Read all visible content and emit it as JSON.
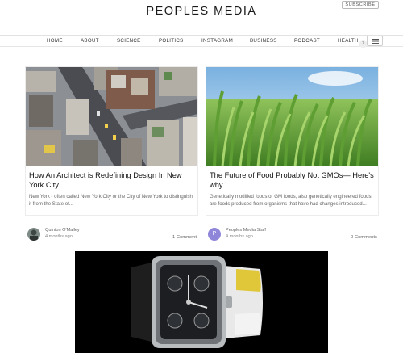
{
  "header": {
    "site_title": "PEOPLES MEDIA",
    "subscribe_label": "SUBSCRIBE"
  },
  "nav": {
    "items": [
      "HOME",
      "ABOUT",
      "SCIENCE",
      "POLITICS",
      "INSTAGRAM",
      "BUSINESS",
      "PODCAST",
      "HEALTH"
    ],
    "badge": "7",
    "menu_icon": "hamburger-icon"
  },
  "articles": [
    {
      "title": "How An Architect is Redefining Design In New York City",
      "excerpt": "New York - often called New York City or the City of New York to distinguish it from the State of...",
      "author": "Quinton O'Malley",
      "date": "4 months ago",
      "comments": "1 Comment",
      "image": "aerial-city-streets"
    },
    {
      "title": "The Future of Food Probably Not GMOs— Here's why",
      "excerpt": "Genetically modified foods or GM foods, also genetically engineered foods, are foods produced from organisms that have had changes introduced...",
      "author": "Peoples Media Staff",
      "author_initial": "P",
      "date": "4 months ago",
      "comments": "0 Comments",
      "image": "wheat-field-sky"
    }
  ],
  "advertisement": {
    "image": "luxury-wristwatch"
  },
  "colors": {
    "text": "#222222",
    "muted": "#666666",
    "border": "#e2e2e2",
    "avatar_purple": "#8f86d9"
  }
}
